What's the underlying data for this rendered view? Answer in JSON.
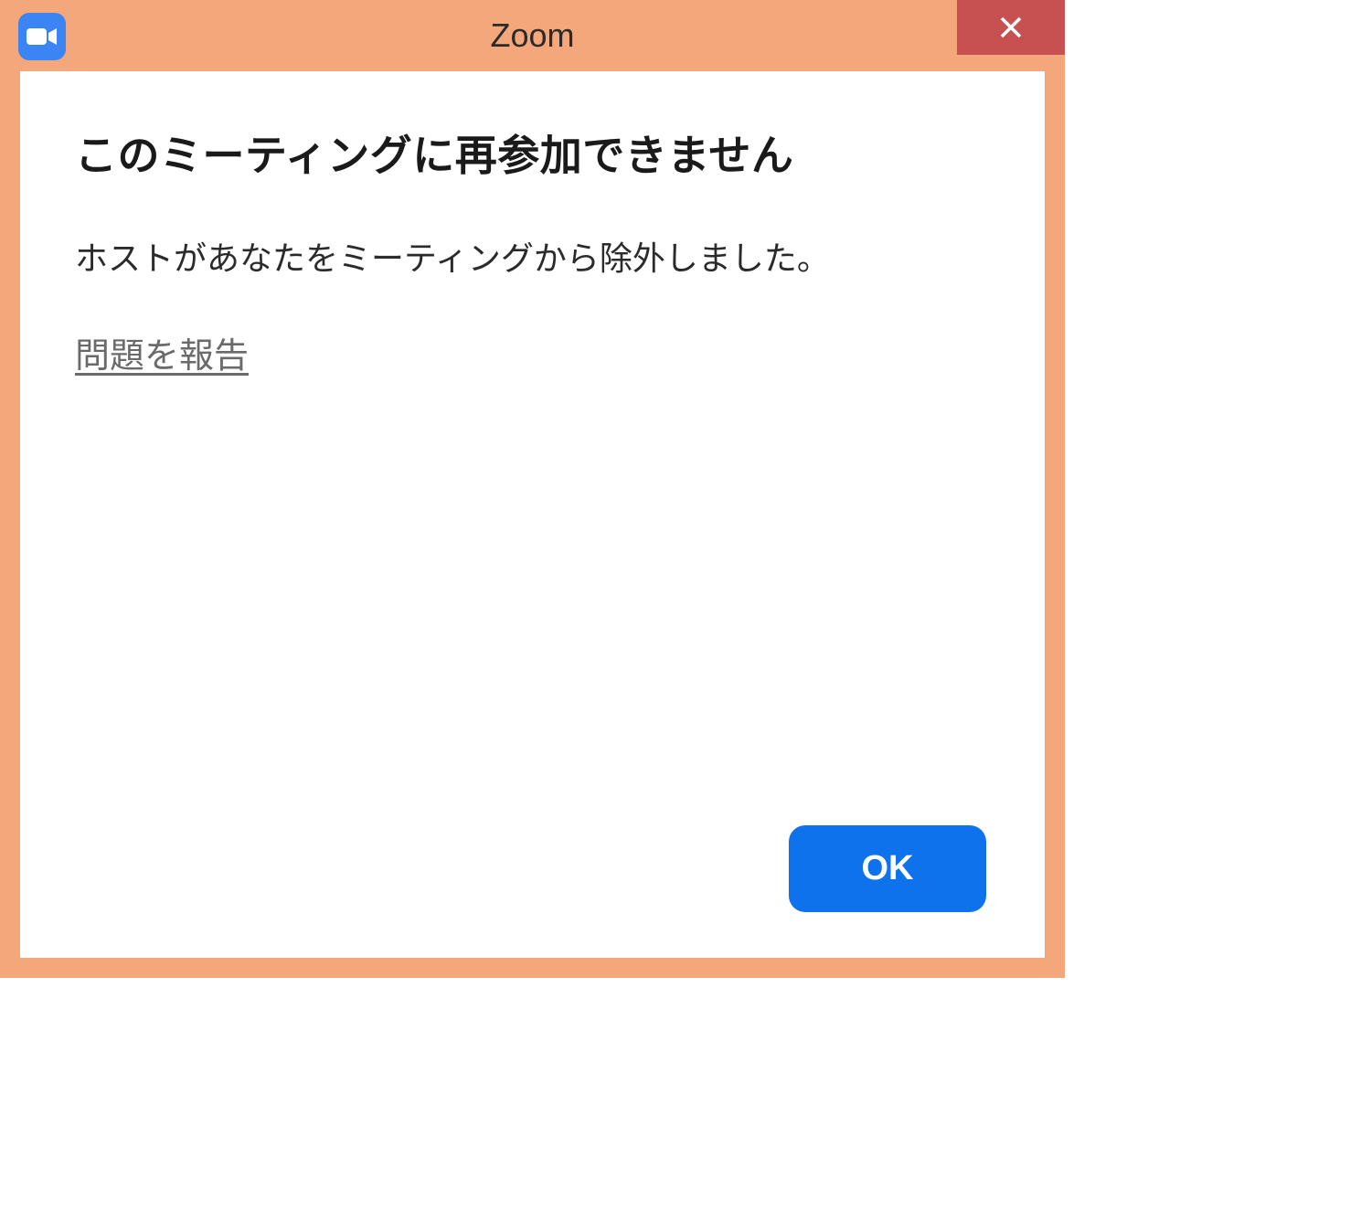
{
  "window": {
    "title": "Zoom"
  },
  "dialog": {
    "heading": "このミーティングに再参加できません",
    "message": "ホストがあなたをミーティングから除外しました。",
    "report_link": "問題を報告",
    "ok_label": "OK"
  },
  "icons": {
    "app": "zoom-camera-icon",
    "close": "close-icon"
  },
  "colors": {
    "frame": "#f3a77a",
    "close": "#c75050",
    "primary": "#0e72ec",
    "link": "#6a6a6a"
  }
}
